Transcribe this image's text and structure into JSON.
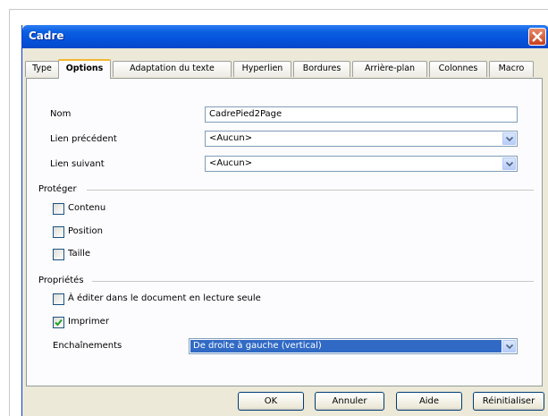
{
  "window": {
    "title": "Cadre"
  },
  "tabs": [
    {
      "label": "Type"
    },
    {
      "label": "Options",
      "active": true
    },
    {
      "label": "Adaptation du texte"
    },
    {
      "label": "Hyperlien"
    },
    {
      "label": "Bordures"
    },
    {
      "label": "Arrière-plan"
    },
    {
      "label": "Colonnes"
    },
    {
      "label": "Macro"
    }
  ],
  "fields": {
    "name_label": "Nom",
    "name_value": "CadrePied2Page",
    "prev_link_label": "Lien précédent",
    "prev_link_value": "<Aucun>",
    "next_link_label": "Lien suivant",
    "next_link_value": "<Aucun>"
  },
  "protect": {
    "title": "Protéger",
    "items": [
      {
        "label": "Contenu",
        "checked": false
      },
      {
        "label": "Position",
        "checked": false
      },
      {
        "label": "Taille",
        "checked": false
      }
    ]
  },
  "properties": {
    "title": "Propriétés",
    "editable_readonly_label": "À éditer dans le document en lecture seule",
    "editable_readonly_checked": false,
    "print_label": "Imprimer",
    "print_checked": true,
    "flow_label": "Enchaînements",
    "flow_value": "De droite à gauche (vertical)"
  },
  "buttons": {
    "ok": "OK",
    "cancel": "Annuler",
    "help": "Aide",
    "reset": "Réinitialiser"
  },
  "colors": {
    "titlebar": "#0554dd",
    "active_tab_accent": "#f5b733",
    "selection": "#316ac5"
  }
}
